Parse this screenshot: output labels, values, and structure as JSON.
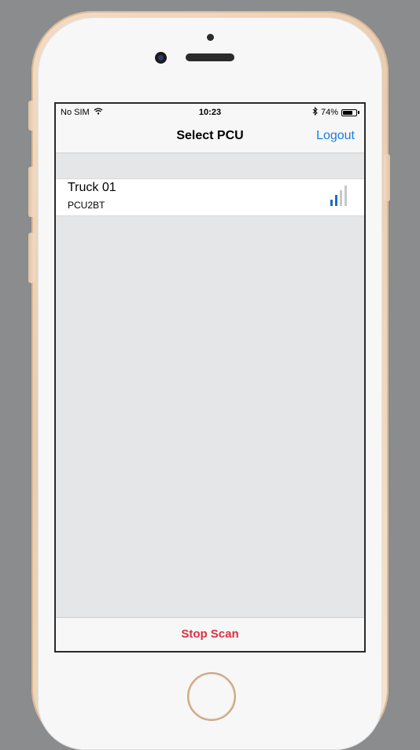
{
  "status_bar": {
    "carrier": "No SIM",
    "wifi_icon": "wifi-icon",
    "time": "10:23",
    "bluetooth_icon": "bluetooth-icon",
    "battery_percent": "74%",
    "battery_level": 0.74
  },
  "nav": {
    "title": "Select PCU",
    "right_action": "Logout"
  },
  "devices": [
    {
      "name": "Truck 01",
      "model": "PCU2BT",
      "signal_icon": "signal-strength-icon",
      "signal_bars_active": 2,
      "signal_bars_total": 4
    }
  ],
  "footer": {
    "action": "Stop Scan"
  },
  "colors": {
    "accent": "#1a7de2",
    "destructive": "#e0303f",
    "signal_active": "#1a6fc4",
    "signal_inactive": "#c8c8c8"
  }
}
